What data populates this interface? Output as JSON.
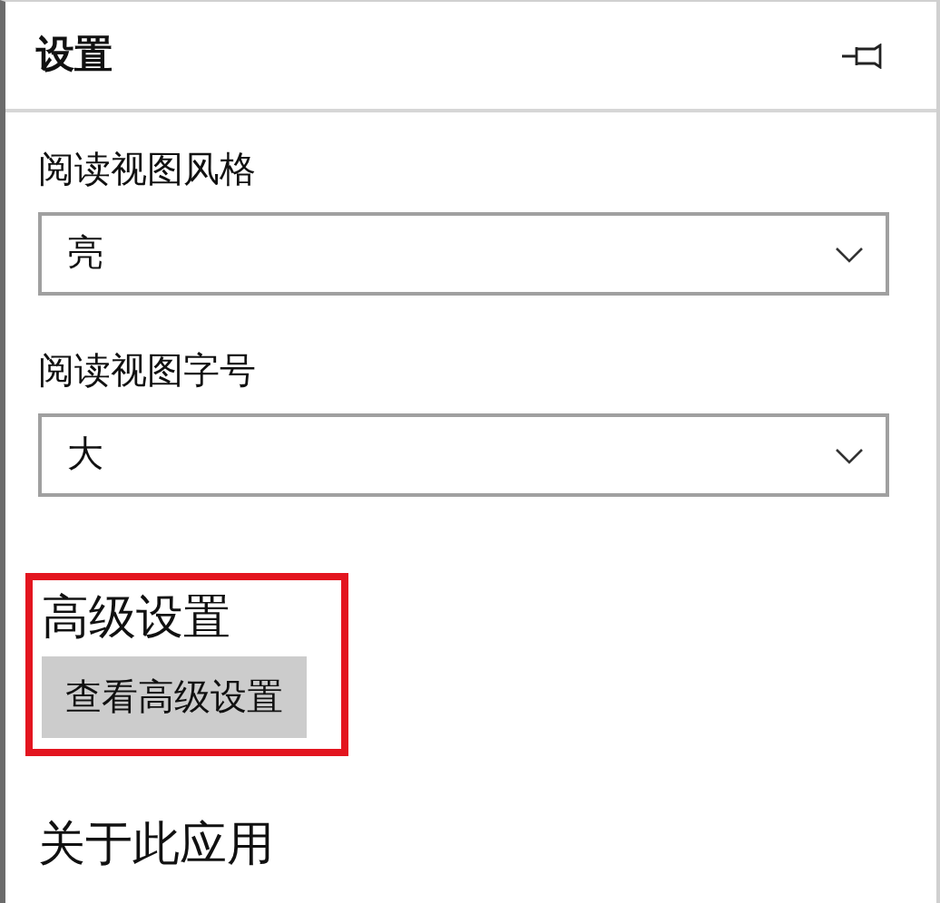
{
  "panel": {
    "title": "设置"
  },
  "settings": [
    {
      "kind": "dropdown",
      "label": "阅读视图风格",
      "value": "亮"
    },
    {
      "kind": "dropdown",
      "label": "阅读视图字号",
      "value": "大"
    }
  ],
  "advanced": {
    "heading": "高级设置",
    "button": "查看高级设置",
    "highlighted": true
  },
  "about": {
    "heading": "关于此应用"
  }
}
